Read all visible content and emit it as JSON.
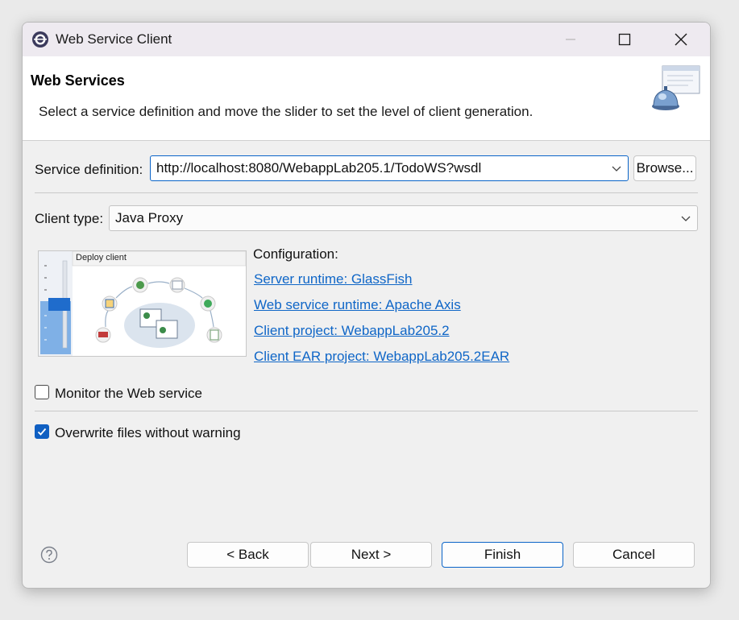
{
  "window": {
    "title": "Web Service Client",
    "controls": {
      "minimize": "minimize",
      "maximize": "maximize",
      "close": "close"
    }
  },
  "banner": {
    "title": "Web Services",
    "description": "Select a service definition and move the slider to set the level of client generation."
  },
  "service_definition": {
    "label": "Service definition:",
    "value": "http://localhost:8080/WebappLab205.1/TodoWS?wsdl",
    "browse_label": "Browse..."
  },
  "client_type": {
    "label": "Client type:",
    "value": "Java Proxy"
  },
  "slider": {
    "caption": "Deploy client"
  },
  "configuration": {
    "heading": "Configuration:",
    "links": [
      "Server runtime: GlassFish",
      "Web service runtime: Apache Axis",
      "Client project: WebappLab205.2",
      "Client EAR project: WebappLab205.2EAR"
    ]
  },
  "options": {
    "monitor": {
      "label": "Monitor the Web service",
      "checked": false
    },
    "overwrite": {
      "label": "Overwrite files without warning",
      "checked": true
    }
  },
  "footer": {
    "back": "< Back",
    "next": "Next >",
    "finish": "Finish",
    "cancel": "Cancel"
  },
  "colors": {
    "accent": "#0f5fc2",
    "link": "#0f66c7",
    "background": "#f0f0f0"
  }
}
